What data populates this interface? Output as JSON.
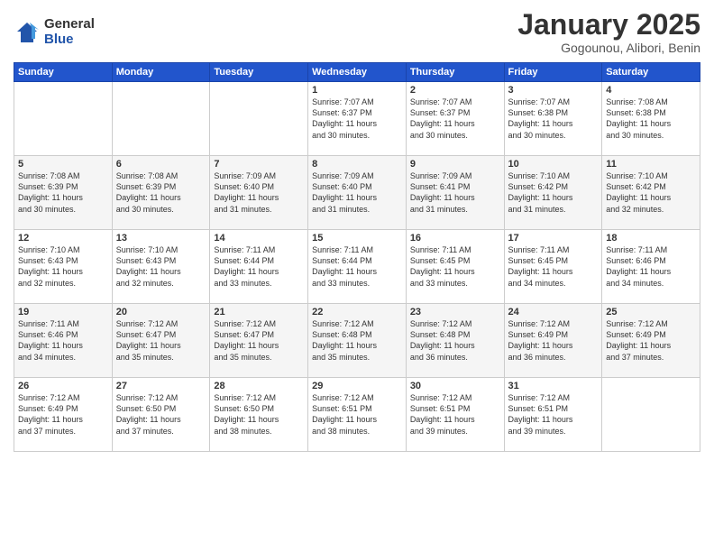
{
  "logo": {
    "general": "General",
    "blue": "Blue"
  },
  "title": {
    "month_year": "January 2025",
    "location": "Gogounou, Alibori, Benin"
  },
  "headers": [
    "Sunday",
    "Monday",
    "Tuesday",
    "Wednesday",
    "Thursday",
    "Friday",
    "Saturday"
  ],
  "weeks": [
    [
      {
        "day": "",
        "info": ""
      },
      {
        "day": "",
        "info": ""
      },
      {
        "day": "",
        "info": ""
      },
      {
        "day": "1",
        "info": "Sunrise: 7:07 AM\nSunset: 6:37 PM\nDaylight: 11 hours\nand 30 minutes."
      },
      {
        "day": "2",
        "info": "Sunrise: 7:07 AM\nSunset: 6:37 PM\nDaylight: 11 hours\nand 30 minutes."
      },
      {
        "day": "3",
        "info": "Sunrise: 7:07 AM\nSunset: 6:38 PM\nDaylight: 11 hours\nand 30 minutes."
      },
      {
        "day": "4",
        "info": "Sunrise: 7:08 AM\nSunset: 6:38 PM\nDaylight: 11 hours\nand 30 minutes."
      }
    ],
    [
      {
        "day": "5",
        "info": "Sunrise: 7:08 AM\nSunset: 6:39 PM\nDaylight: 11 hours\nand 30 minutes."
      },
      {
        "day": "6",
        "info": "Sunrise: 7:08 AM\nSunset: 6:39 PM\nDaylight: 11 hours\nand 30 minutes."
      },
      {
        "day": "7",
        "info": "Sunrise: 7:09 AM\nSunset: 6:40 PM\nDaylight: 11 hours\nand 31 minutes."
      },
      {
        "day": "8",
        "info": "Sunrise: 7:09 AM\nSunset: 6:40 PM\nDaylight: 11 hours\nand 31 minutes."
      },
      {
        "day": "9",
        "info": "Sunrise: 7:09 AM\nSunset: 6:41 PM\nDaylight: 11 hours\nand 31 minutes."
      },
      {
        "day": "10",
        "info": "Sunrise: 7:10 AM\nSunset: 6:42 PM\nDaylight: 11 hours\nand 31 minutes."
      },
      {
        "day": "11",
        "info": "Sunrise: 7:10 AM\nSunset: 6:42 PM\nDaylight: 11 hours\nand 32 minutes."
      }
    ],
    [
      {
        "day": "12",
        "info": "Sunrise: 7:10 AM\nSunset: 6:43 PM\nDaylight: 11 hours\nand 32 minutes."
      },
      {
        "day": "13",
        "info": "Sunrise: 7:10 AM\nSunset: 6:43 PM\nDaylight: 11 hours\nand 32 minutes."
      },
      {
        "day": "14",
        "info": "Sunrise: 7:11 AM\nSunset: 6:44 PM\nDaylight: 11 hours\nand 33 minutes."
      },
      {
        "day": "15",
        "info": "Sunrise: 7:11 AM\nSunset: 6:44 PM\nDaylight: 11 hours\nand 33 minutes."
      },
      {
        "day": "16",
        "info": "Sunrise: 7:11 AM\nSunset: 6:45 PM\nDaylight: 11 hours\nand 33 minutes."
      },
      {
        "day": "17",
        "info": "Sunrise: 7:11 AM\nSunset: 6:45 PM\nDaylight: 11 hours\nand 34 minutes."
      },
      {
        "day": "18",
        "info": "Sunrise: 7:11 AM\nSunset: 6:46 PM\nDaylight: 11 hours\nand 34 minutes."
      }
    ],
    [
      {
        "day": "19",
        "info": "Sunrise: 7:11 AM\nSunset: 6:46 PM\nDaylight: 11 hours\nand 34 minutes."
      },
      {
        "day": "20",
        "info": "Sunrise: 7:12 AM\nSunset: 6:47 PM\nDaylight: 11 hours\nand 35 minutes."
      },
      {
        "day": "21",
        "info": "Sunrise: 7:12 AM\nSunset: 6:47 PM\nDaylight: 11 hours\nand 35 minutes."
      },
      {
        "day": "22",
        "info": "Sunrise: 7:12 AM\nSunset: 6:48 PM\nDaylight: 11 hours\nand 35 minutes."
      },
      {
        "day": "23",
        "info": "Sunrise: 7:12 AM\nSunset: 6:48 PM\nDaylight: 11 hours\nand 36 minutes."
      },
      {
        "day": "24",
        "info": "Sunrise: 7:12 AM\nSunset: 6:49 PM\nDaylight: 11 hours\nand 36 minutes."
      },
      {
        "day": "25",
        "info": "Sunrise: 7:12 AM\nSunset: 6:49 PM\nDaylight: 11 hours\nand 37 minutes."
      }
    ],
    [
      {
        "day": "26",
        "info": "Sunrise: 7:12 AM\nSunset: 6:49 PM\nDaylight: 11 hours\nand 37 minutes."
      },
      {
        "day": "27",
        "info": "Sunrise: 7:12 AM\nSunset: 6:50 PM\nDaylight: 11 hours\nand 37 minutes."
      },
      {
        "day": "28",
        "info": "Sunrise: 7:12 AM\nSunset: 6:50 PM\nDaylight: 11 hours\nand 38 minutes."
      },
      {
        "day": "29",
        "info": "Sunrise: 7:12 AM\nSunset: 6:51 PM\nDaylight: 11 hours\nand 38 minutes."
      },
      {
        "day": "30",
        "info": "Sunrise: 7:12 AM\nSunset: 6:51 PM\nDaylight: 11 hours\nand 39 minutes."
      },
      {
        "day": "31",
        "info": "Sunrise: 7:12 AM\nSunset: 6:51 PM\nDaylight: 11 hours\nand 39 minutes."
      },
      {
        "day": "",
        "info": ""
      }
    ]
  ]
}
